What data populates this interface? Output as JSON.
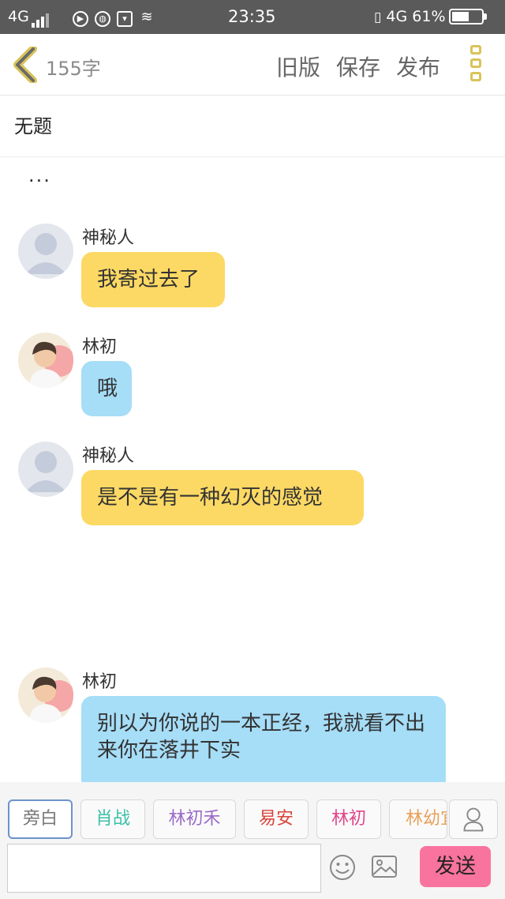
{
  "status_bar": {
    "network_left": "4G",
    "time": "23:35",
    "network_right": "4G",
    "battery_percent": "61%",
    "battery_level": 0.61
  },
  "header": {
    "word_count": "155字",
    "old_version_label": "旧版",
    "save_label": "保存",
    "publish_label": "发布",
    "accent_color": "#d9c35a"
  },
  "doc": {
    "title": "无题",
    "ellipsis": "..."
  },
  "messages": [
    {
      "sender": "神秘人",
      "text": "我寄过去了",
      "color": "yellow",
      "avatar": "default-avatar"
    },
    {
      "sender": "林初",
      "text": "哦",
      "color": "blue",
      "avatar": "photo-avatar"
    },
    {
      "sender": "神秘人",
      "text": "是不是有一种幻灭的感觉",
      "color": "yellow",
      "avatar": "default-avatar"
    },
    {
      "sender": "林初",
      "text": "别以为你说的一本正经，我就看不出来你在落井下实",
      "color": "blue",
      "avatar": "photo-avatar"
    }
  ],
  "roles": [
    {
      "label": "旁白",
      "color": "#777777",
      "active": true
    },
    {
      "label": "肖战",
      "color": "#3bbfa8",
      "active": false
    },
    {
      "label": "林初禾",
      "color": "#9b6bc9",
      "active": false
    },
    {
      "label": "易安",
      "color": "#d9443c",
      "active": false
    },
    {
      "label": "林初",
      "color": "#e0458a",
      "active": false
    },
    {
      "label": "林幼宜",
      "color": "#e8a15a",
      "active": false
    }
  ],
  "composer": {
    "input_value": "",
    "send_label": "发送",
    "send_color": "#f9739f"
  }
}
